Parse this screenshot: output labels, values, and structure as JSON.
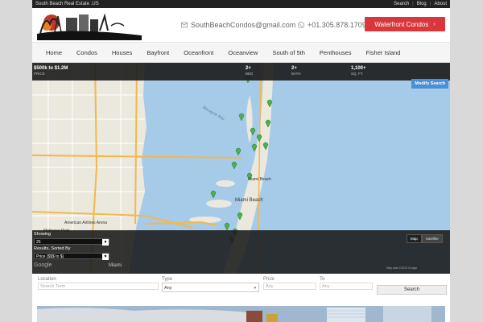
{
  "topbar": {
    "site_name": "South Beach Real Estate .US",
    "links": [
      "Search",
      "Blog",
      "About"
    ]
  },
  "header": {
    "email": "SouthBeachCondos@gmail.com",
    "phone": "+01.305.878.1709",
    "cta": "Waterfront Condos"
  },
  "nav": [
    "Home",
    "Condos",
    "Houses",
    "Bayfront",
    "Oceanfront",
    "Oceanview",
    "South of 5th",
    "Penthouses",
    "Fisher Island"
  ],
  "filters": {
    "price": {
      "value": "$500k to $1.2M",
      "label": "PRICE"
    },
    "bed": {
      "value": "2+",
      "label": "BED"
    },
    "bath": {
      "value": "2+",
      "label": "BATH"
    },
    "sqft": {
      "value": "1,100+",
      "label": "SQ. FT."
    },
    "modify": "Modify Search"
  },
  "map": {
    "labels": {
      "miami_beach_n": "Miami Beach",
      "miami_beach_s": "Miami Beach",
      "biscayne_bay": "Biscayne Bay",
      "miami": "Miami",
      "arena": "American Airlines Arena",
      "park": "Melreese Park"
    },
    "map_type": [
      "Map",
      "Satellite"
    ],
    "google": "Google",
    "footer": "Map data ©2015 Google"
  },
  "results": {
    "showing_label": "Showing",
    "showing_value": "25",
    "sorted_label": "Results, Sorted By",
    "sorted_value": "Price ($$$ to $)"
  },
  "search": {
    "location_label": "Location",
    "location_placeholder": "Search Term",
    "type_label": "Type",
    "type_value": "Any",
    "price_label": "Price",
    "price_placeholder": "Any",
    "to_label": "To",
    "to_placeholder": "Any",
    "button": "Search"
  },
  "colors": {
    "accent": "#d9373b",
    "map_water": "#a6cbe9",
    "map_land": "#ebe8de",
    "marker": "#4caf50",
    "modify": "#4a90d9"
  }
}
